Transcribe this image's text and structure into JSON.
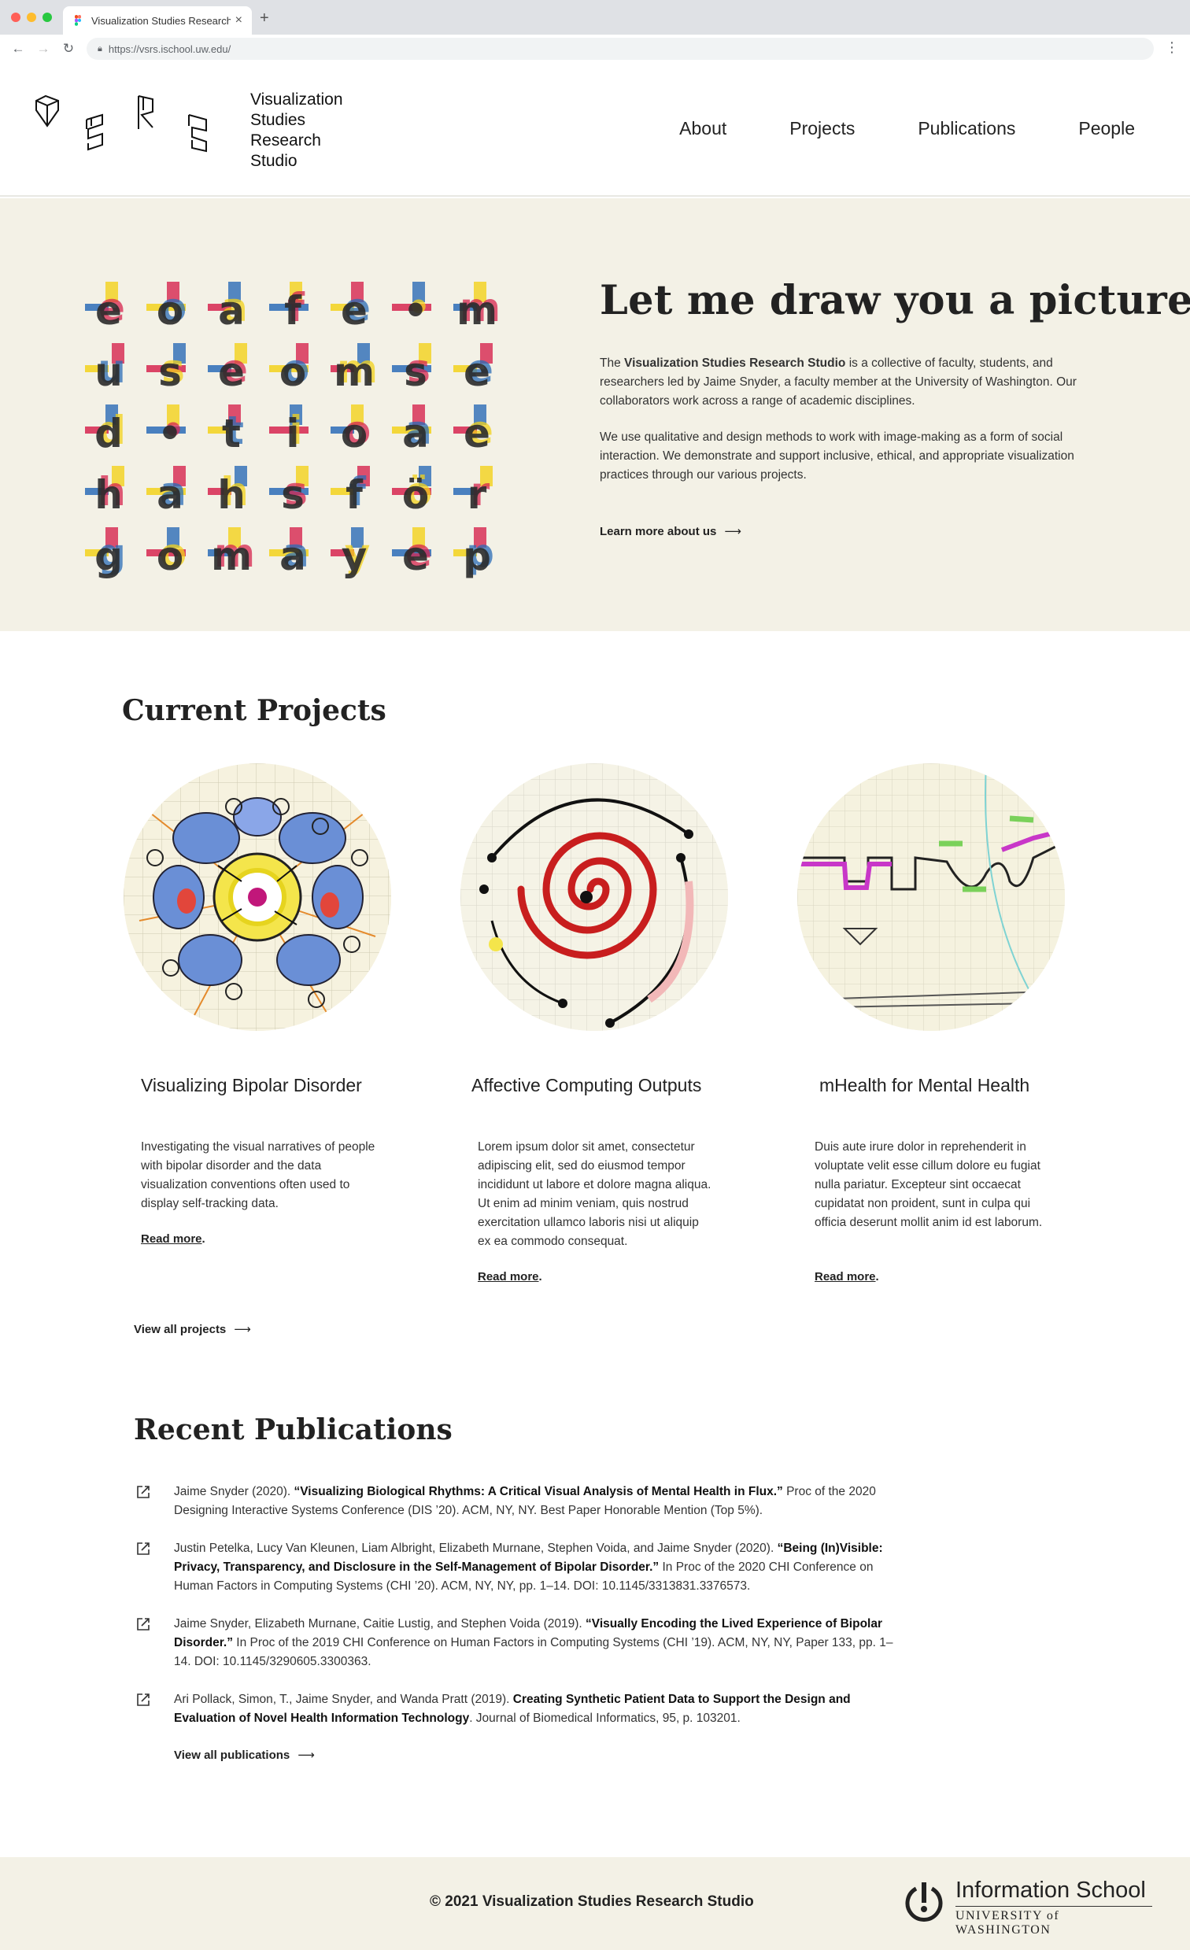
{
  "browser": {
    "tab_title": "Visualization Studies Research",
    "url": "https://vsrs.ischool.uw.edu/",
    "dots": [
      "#ff5f57",
      "#febc2e",
      "#28c840"
    ]
  },
  "header": {
    "logo_lines": [
      "Visualization",
      "Studies",
      "Research",
      "Studio"
    ],
    "nav": [
      "About",
      "Projects",
      "Publications",
      "People"
    ]
  },
  "hero": {
    "title": "Let me draw you a picture...",
    "p1_lead": "The ",
    "p1_bold": "Visualization Studies Research Studio",
    "p1_rest": " is a collective of faculty, students, and researchers led by Jaime Snyder, a faculty member at the University of Washington. Our collaborators work across a range of academic disciplines.",
    "p2": "We use qualitative and design methods to work with image-making as a form of social interaction. We demonstrate and support inclusive, ethical, and appropriate visualization practices through our various projects.",
    "link": "Learn more about us",
    "arrow": "⟶",
    "letter_rows": [
      [
        "e",
        "o",
        "a",
        "f",
        "e",
        "•",
        "m"
      ],
      [
        "u",
        "s",
        "e",
        "o",
        "m",
        "s",
        "e"
      ],
      [
        "d",
        "•",
        "t",
        "i",
        "o",
        "a",
        "e"
      ],
      [
        "h",
        "a",
        "h",
        "s",
        "f",
        "ö",
        "r"
      ],
      [
        "g",
        "o",
        "m",
        "a",
        "y",
        "e",
        "p"
      ]
    ]
  },
  "projects": {
    "title": "Current Projects",
    "items": [
      {
        "title": "Visualizing Bipolar Disorder",
        "desc": "Investigating the visual narratives of people with bipolar disorder and the data visualization conventions often used to display self-tracking data.",
        "more": "Read more"
      },
      {
        "title": "Affective Computing Outputs",
        "desc": "Lorem ipsum dolor sit amet, consectetur adipiscing elit, sed do eiusmod tempor incididunt ut labore et dolore magna aliqua. Ut enim ad minim veniam, quis nostrud exercitation ullamco laboris nisi ut aliquip ex ea commodo consequat.",
        "more": "Read more"
      },
      {
        "title": "mHealth for Mental Health",
        "desc": "Duis aute irure dolor in reprehenderit in voluptate velit esse cillum dolore eu fugiat nulla pariatur. Excepteur sint occaecat cupidatat non proident, sunt in culpa qui officia deserunt mollit anim id est laborum.",
        "more": "Read more"
      }
    ],
    "view_all": "View all projects"
  },
  "publications": {
    "title": "Recent Publications",
    "items": [
      {
        "pre": "Jaime Snyder (2020). ",
        "bold": "“Visualizing Biological Rhythms: A Critical Visual Analysis of Mental Health in Flux.”",
        "post": " Proc of the 2020 Designing Interactive Systems Conference (DIS ’20). ACM, NY, NY. Best Paper Honorable Mention (Top 5%)."
      },
      {
        "pre": "Justin Petelka, Lucy Van Kleunen, Liam Albright, Elizabeth Murnane, Stephen Voida, and Jaime Snyder (2020). ",
        "bold": "“Being (In)Visible: Privacy, Transparency, and Disclosure in the Self-Management of Bipolar Disorder.”",
        "post": " In Proc of the 2020 CHI Conference on Human Factors in Computing Systems (CHI ’20). ACM, NY, NY, pp. 1–14. DOI: 10.1145/3313831.3376573."
      },
      {
        "pre": "Jaime Snyder, Elizabeth Murnane, Caitie Lustig, and Stephen Voida (2019). ",
        "bold": "“Visually Encoding the Lived Experience of Bipolar Disorder.”",
        "post": " In Proc of the 2019 CHI Conference on Human Factors in Computing Systems (CHI ’19). ACM, NY, NY, Paper 133, pp. 1–14. DOI: 10.1145/3290605.3300363."
      },
      {
        "pre": "Ari Pollack, Simon, T., Jaime Snyder, and Wanda Pratt (2019). ",
        "bold": "Creating Synthetic Patient Data to Support the Design and Evaluation of Novel Health Information Technology",
        "post": ". Journal of Biomedical Informatics, 95, p. 103201."
      }
    ],
    "view_all": "View all publications"
  },
  "footer": {
    "copyright": "© 2021 Visualization Studies Research Studio",
    "ischool_name": "Information School",
    "ischool_uw": "UNIVERSITY of WASHINGTON"
  }
}
